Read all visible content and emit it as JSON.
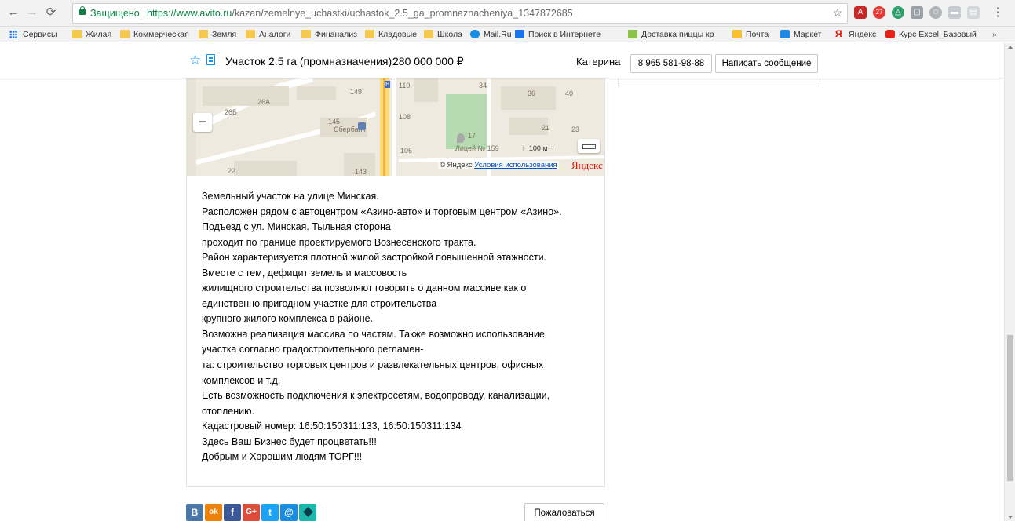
{
  "browser": {
    "secure_label": "Защищено",
    "url_host": "https://www.avito.ru",
    "url_path": "/kazan/zemelnye_uchastki/uchastok_2.5_ga_promnaznacheniya_1347872685",
    "extension_badge": "27",
    "bookmarks": [
      {
        "label": "Сервисы",
        "icon": "apps-grid-icon"
      },
      {
        "label": "Жилая",
        "icon": "folder-icon"
      },
      {
        "label": "Коммерческая",
        "icon": "folder-icon"
      },
      {
        "label": "Земля",
        "icon": "folder-icon"
      },
      {
        "label": "Аналоги",
        "icon": "folder-icon"
      },
      {
        "label": "Финанализ",
        "icon": "folder-icon"
      },
      {
        "label": "Кладовые",
        "icon": "folder-icon"
      },
      {
        "label": "Школа",
        "icon": "folder-icon"
      },
      {
        "label": "Mail.Ru",
        "icon": "mailru-icon"
      },
      {
        "label": "Поиск в Интернете",
        "icon": "search-icon"
      },
      {
        "label": "Доставка пиццы кр",
        "icon": "pizza-icon"
      },
      {
        "label": "Почта",
        "icon": "mail-icon"
      },
      {
        "label": "Маркет",
        "icon": "cart-icon"
      },
      {
        "label": "Яндекс",
        "icon": "yandex-icon"
      },
      {
        "label": "Курс Excel_Базовый",
        "icon": "youtube-icon"
      }
    ],
    "more_bookmarks": "»"
  },
  "header": {
    "title": "Участок 2.5 га (промназначения)",
    "price": "280 000 000 ₽",
    "seller_name": "Катерина",
    "phone": "8 965 581-98-88",
    "message_button": "Написать сообщение"
  },
  "map": {
    "labels": [
      "110",
      "149",
      "34",
      "36",
      "40",
      "26А",
      "26Б",
      "145",
      "Сбербанк",
      "108",
      "21",
      "23",
      "17",
      "106",
      "Лицей № 159",
      "22",
      "143"
    ],
    "scale": "100 м",
    "copyright": "© Яндекс",
    "terms_link": "Условия использования",
    "logo": "Яндекс",
    "zoom_out": "−"
  },
  "description": [
    "Земельный участок на улице Минская.",
    "Расположен рядом с автоцентром «Азино-авто» и торговым центром «Азино».",
    "Подъезд с ул. Минская. Тыльная сторона",
    "проходит по границе проектируемого Вознесенского тракта.",
    "Район характеризуется плотной жилой застройкой повышенной этажности.",
    "Вместе с тем, дефицит земель и массовость",
    "жилищного строительства позволяют говорить о данном массиве как о",
    "единственно пригодном участке для строительства",
    "крупного жилого комплекса в районе.",
    "Возможна реализация массива по частям. Также возможно использование",
    "участка согласно градостроительного регламен-",
    "та: строительство торговых центров и развлекательных центров, офисных",
    "комплексов и т.д.",
    "Есть возможность подключения к электросетям, водопроводу, канализации,",
    "отоплению.",
    "Кадастровый номер: 16:50:150311:133, 16:50:150311:134",
    "Здесь Ваш Бизнес будет процветать!!!",
    "Добрым и Хорошим людям ТОРГ!!!"
  ],
  "share": [
    {
      "label": "В",
      "color": "#4a76a8",
      "icon": "vk-icon"
    },
    {
      "label": "ok",
      "color": "#ee8208",
      "icon": "odnoklassniki-icon"
    },
    {
      "label": "f",
      "color": "#3b5998",
      "icon": "facebook-icon"
    },
    {
      "label": "G+",
      "color": "#dd4b39",
      "icon": "google-plus-icon"
    },
    {
      "label": "t",
      "color": "#1da1f2",
      "icon": "twitter-icon"
    },
    {
      "label": "@",
      "color": "#168de2",
      "icon": "mailru-share-icon"
    },
    {
      "label": "",
      "color": "#1cb7ab",
      "icon": "livejournal-icon"
    }
  ],
  "report_button": "Пожаловаться",
  "colors": {
    "accent": "#0a95ff",
    "secure": "#0b8043"
  }
}
